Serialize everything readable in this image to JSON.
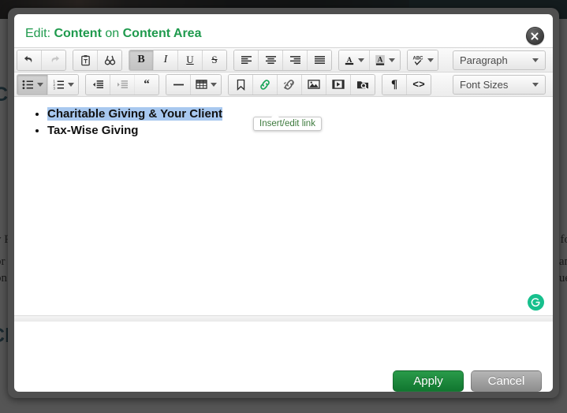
{
  "background": {
    "heading_top": "Charitable Giving & Your Client",
    "heading_bottom": "Client",
    "paragraph_left_1": "y P",
    "paragraph_left_2": "pr",
    "paragraph_left_3": "on",
    "paragraph_right_1": "fo",
    "paragraph_right_2": "an",
    "paragraph_right_3": "ue"
  },
  "modal": {
    "title_prefix": "Edit:",
    "title_target": "Content",
    "title_joiner": "on",
    "title_region": "Content Area",
    "close_icon": "close-icon",
    "accent_color": "#1f9a4d"
  },
  "toolbar": {
    "row1": [
      {
        "name": "undo-button",
        "icon": "undo-icon",
        "label": "Undo",
        "state": "enabled",
        "caret": false
      },
      {
        "name": "redo-button",
        "icon": "redo-icon",
        "label": "Redo",
        "state": "disabled",
        "caret": false
      },
      {
        "name": "paste-as-text-button",
        "icon": "paste-text-icon",
        "label": "Paste as text",
        "state": "enabled",
        "caret": false
      },
      {
        "name": "find-replace-button",
        "icon": "find-replace-icon",
        "label": "Find and replace",
        "state": "enabled",
        "caret": false
      },
      {
        "name": "bold-button",
        "icon": "bold-icon",
        "label": "Bold",
        "state": "active",
        "caret": false
      },
      {
        "name": "italic-button",
        "icon": "italic-icon",
        "label": "Italic",
        "state": "enabled",
        "caret": false
      },
      {
        "name": "underline-button",
        "icon": "underline-icon",
        "label": "Underline",
        "state": "enabled",
        "caret": false
      },
      {
        "name": "strikethrough-button",
        "icon": "strikethrough-icon",
        "label": "Strikethrough",
        "state": "enabled",
        "caret": false
      },
      {
        "name": "align-left-button",
        "icon": "align-left-icon",
        "label": "Align left",
        "state": "enabled",
        "caret": false
      },
      {
        "name": "align-center-button",
        "icon": "align-center-icon",
        "label": "Align center",
        "state": "enabled",
        "caret": false
      },
      {
        "name": "align-right-button",
        "icon": "align-right-icon",
        "label": "Align right",
        "state": "enabled",
        "caret": false
      },
      {
        "name": "align-justify-button",
        "icon": "align-justify-icon",
        "label": "Justify",
        "state": "enabled",
        "caret": false
      },
      {
        "name": "text-color-button",
        "icon": "text-color-icon",
        "label": "Text color",
        "state": "enabled",
        "caret": true
      },
      {
        "name": "background-color-button",
        "icon": "background-color-icon",
        "label": "Background color",
        "state": "enabled",
        "caret": true
      },
      {
        "name": "spellcheck-button",
        "icon": "spellcheck-icon",
        "label": "Spellcheck",
        "state": "enabled",
        "caret": true
      }
    ],
    "row2": [
      {
        "name": "bullet-list-button",
        "icon": "bullet-list-icon",
        "label": "Bullet list",
        "state": "active",
        "caret": true
      },
      {
        "name": "numbered-list-button",
        "icon": "numbered-list-icon",
        "label": "Numbered list",
        "state": "enabled",
        "caret": true
      },
      {
        "name": "outdent-button",
        "icon": "outdent-icon",
        "label": "Decrease indent",
        "state": "enabled",
        "caret": false
      },
      {
        "name": "indent-button",
        "icon": "indent-icon",
        "label": "Increase indent",
        "state": "disabled",
        "caret": false
      },
      {
        "name": "blockquote-button",
        "icon": "blockquote-icon",
        "label": "Blockquote",
        "state": "enabled",
        "caret": false
      },
      {
        "name": "horizontal-rule-button",
        "icon": "horizontal-rule-icon",
        "label": "Horizontal line",
        "state": "enabled",
        "caret": false
      },
      {
        "name": "table-button",
        "icon": "table-icon",
        "label": "Table",
        "state": "enabled",
        "caret": true
      },
      {
        "name": "anchor-button",
        "icon": "bookmark-icon",
        "label": "Anchor",
        "state": "enabled",
        "caret": false
      },
      {
        "name": "insert-link-button",
        "icon": "link-icon",
        "label": "Insert/edit link",
        "state": "hover",
        "caret": false
      },
      {
        "name": "unlink-button",
        "icon": "unlink-icon",
        "label": "Remove link",
        "state": "enabled",
        "caret": false
      },
      {
        "name": "insert-image-button",
        "icon": "image-icon",
        "label": "Insert/edit image",
        "state": "enabled",
        "caret": false
      },
      {
        "name": "insert-media-button",
        "icon": "media-icon",
        "label": "Insert/edit media",
        "state": "enabled",
        "caret": false
      },
      {
        "name": "file-browser-button",
        "icon": "file-browser-icon",
        "label": "Browse files",
        "state": "enabled",
        "caret": false
      },
      {
        "name": "show-invisibles-button",
        "icon": "pilcrow-icon",
        "label": "Show invisible characters",
        "state": "enabled",
        "caret": false
      },
      {
        "name": "source-code-button",
        "icon": "source-code-icon",
        "label": "Source code",
        "state": "enabled",
        "caret": false
      }
    ],
    "paragraph_select": "Paragraph",
    "fontsize_select": "Font Sizes"
  },
  "tooltip": {
    "text": "Insert/edit link"
  },
  "editor": {
    "list_items": [
      {
        "text": "Charitable Giving & Your Client",
        "selected": true
      },
      {
        "text": "Tax-Wise Giving",
        "selected": false
      }
    ],
    "grammarly_glyph": "G"
  },
  "footer": {
    "apply_label": "Apply",
    "cancel_label": "Cancel"
  }
}
